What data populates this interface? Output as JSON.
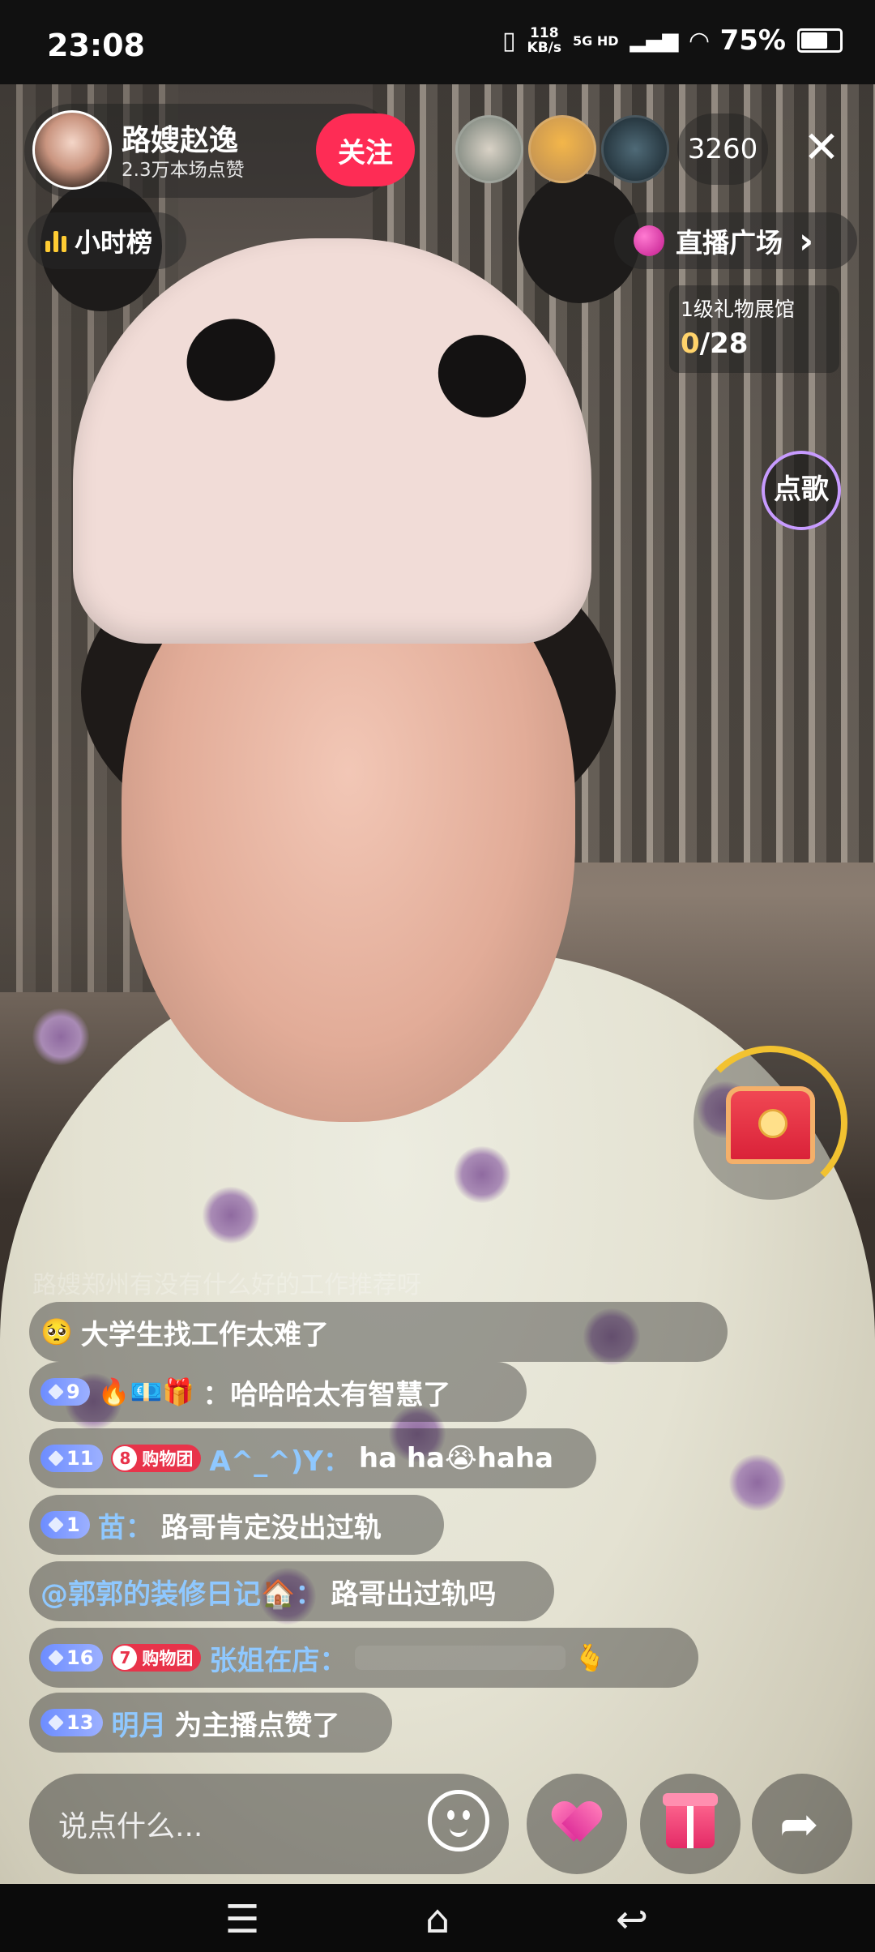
{
  "status_bar": {
    "time": "23:08",
    "net_speed_value": "118",
    "net_speed_unit": "KB/s",
    "network": "5G HD",
    "battery": "75%",
    "battery_level": 0.75
  },
  "host": {
    "name": "路嫂赵逸",
    "likes": "2.3万本场点赞",
    "follow_label": "关注"
  },
  "viewer_count": "3260",
  "close_icon": "✕",
  "hourly_rank": "小时榜",
  "live_plaza": "直播广场",
  "live_plaza_arrow": "›",
  "gift_gallery": {
    "title": "1级礼物展馆",
    "current": "0",
    "total": "/28"
  },
  "song_request": "点歌",
  "chat_faded": "路嫂郑州有没有什么好的工作推荐呀",
  "chat": [
    {
      "emoji": "🥺",
      "text": "大学生找工作太难了"
    },
    {
      "level": "9",
      "emojis": "🔥💶🎁",
      "text": "：哈哈哈太有智慧了"
    },
    {
      "level": "11",
      "fan_level": "8",
      "fan_label": "购物团",
      "user": "A^_^)Y：",
      "text": "ha ha😭haha"
    },
    {
      "level": "1",
      "user": "苗：",
      "text": "路哥肯定没出过轨"
    },
    {
      "user": "@郭郭的装修日记🏠：",
      "text": "路哥出过轨吗"
    },
    {
      "level": "16",
      "fan_level": "7",
      "fan_label": "购物团",
      "user": "张姐在店：",
      "emoji": "🫰"
    },
    {
      "level": "13",
      "user": "明月",
      "text": "为主播点赞了"
    }
  ],
  "input": {
    "placeholder": "说点什么..."
  },
  "nav": {
    "menu": "☰",
    "home": "⌂",
    "back": "↩"
  },
  "colors": {
    "follow": "#fe2c55",
    "username": "#8fc8ff",
    "level_badge": "#6d8dff",
    "fan_badge": "#e8334a",
    "gallery_progress": "#ffd36b"
  }
}
